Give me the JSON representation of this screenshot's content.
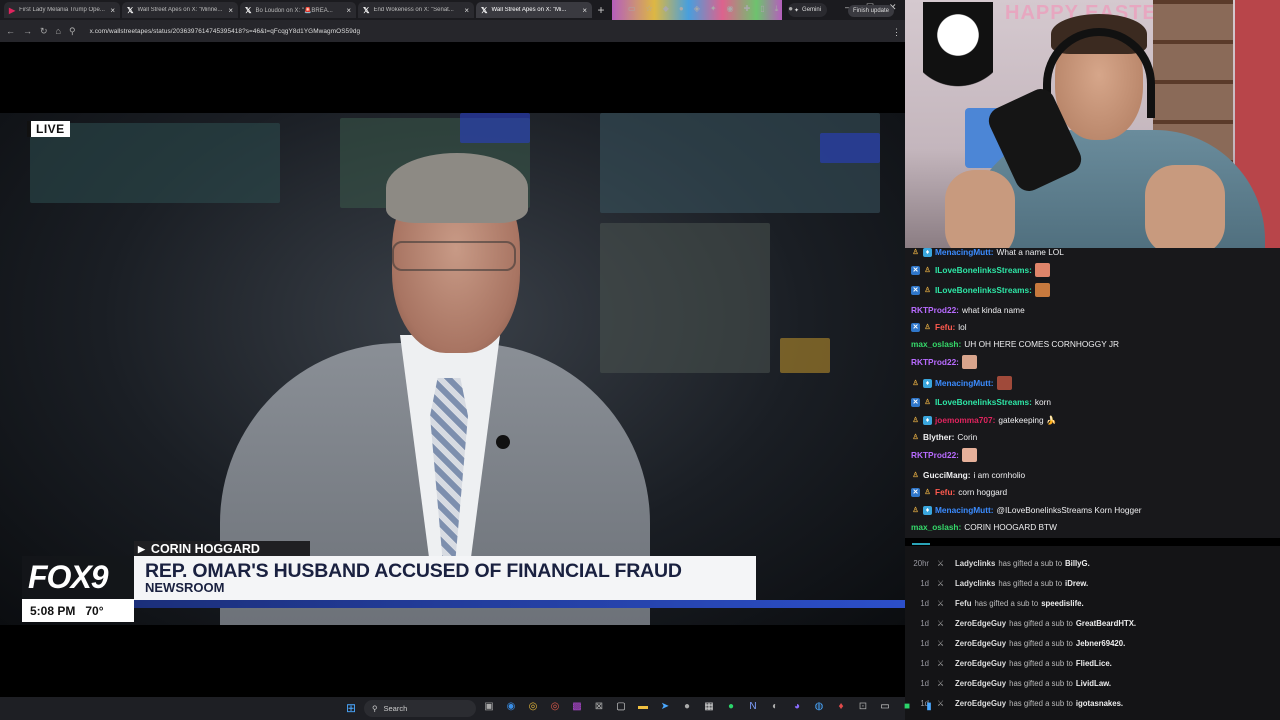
{
  "browser": {
    "tabs": [
      {
        "title": "First Lady Melania Trump Ope...",
        "icon": "youtube-icon",
        "active": false
      },
      {
        "title": "Wall Street Apes on X: \"Minne...",
        "icon": "x-icon",
        "active": false
      },
      {
        "title": "Bo Loudon on X: \"🚨BREA...",
        "icon": "x-icon",
        "active": false
      },
      {
        "title": "End Wokeness on X: \"Senat...",
        "icon": "x-icon",
        "active": false
      },
      {
        "title": "Wall Street Apes on X: \"Mi...",
        "icon": "x-icon",
        "active": true
      }
    ],
    "new_tab": "+",
    "gemini_label": "Gemini",
    "url": "x.com/wallstreetapes/status/2036397614745395418?s=46&t=qFcqgY8d1YGMwagmOS59dg",
    "finish_update": "Finish update"
  },
  "video": {
    "live_badge": "LIVE",
    "reporter_name": "CORIN HOGGARD",
    "network_logo": "FOX9",
    "time": "5:08 PM",
    "temperature": "70°",
    "headline": "REP. OMAR'S HUSBAND ACCUSED OF FINANCIAL FRAUD",
    "subline": "NEWSROOM"
  },
  "webcam": {
    "banner": "HAPPY EASTER"
  },
  "chat": {
    "messages": [
      {
        "user": "MenacingMutt:",
        "text": "What a name LOL",
        "color": "#3b8cff",
        "badges": [
          "gift",
          "prime"
        ]
      },
      {
        "user": "ILoveBonelinksStreams:",
        "text": "",
        "color": "#2ee6a6",
        "badges": [
          "sub",
          "gift"
        ],
        "emote": "#e0856a"
      },
      {
        "user": "ILoveBonelinksStreams:",
        "text": "",
        "color": "#2ee6a6",
        "badges": [
          "sub",
          "gift"
        ],
        "emote": "#c7793e"
      },
      {
        "user": "RKTProd22:",
        "text": "what kinda name",
        "color": "#b86bff",
        "badges": []
      },
      {
        "user": "Fefu:",
        "text": "lol",
        "color": "#ff5a4f",
        "badges": [
          "sub",
          "gift"
        ]
      },
      {
        "user": "max_oslash:",
        "text": "UH OH HERE COMES CORNHOGGY JR",
        "color": "#35d96a",
        "badges": []
      },
      {
        "user": "RKTProd22:",
        "text": "",
        "color": "#b86bff",
        "badges": [],
        "emote": "#d8a48c"
      },
      {
        "user": "MenacingMutt:",
        "text": "",
        "color": "#3b8cff",
        "badges": [
          "gift",
          "prime"
        ],
        "emote": "#a04a3a"
      },
      {
        "user": "ILoveBonelinksStreams:",
        "text": "korn",
        "color": "#2ee6a6",
        "badges": [
          "sub",
          "gift"
        ]
      },
      {
        "user": "joemomma707:",
        "text": "gatekeeping 🍌",
        "color": "#e0245e",
        "badges": [
          "gift",
          "prime"
        ]
      },
      {
        "user": "Blyther:",
        "text": "Corin",
        "color": "#efeff1",
        "badges": [
          "gift"
        ]
      },
      {
        "user": "RKTProd22:",
        "text": "",
        "color": "#b86bff",
        "badges": [],
        "emote": "#e6b09a"
      },
      {
        "user": "GucciMang:",
        "text": "i am cornholio",
        "color": "#efeff1",
        "badges": [
          "gift"
        ]
      },
      {
        "user": "Fefu:",
        "text": "corn hoggard",
        "color": "#ff5a4f",
        "badges": [
          "sub",
          "gift"
        ]
      },
      {
        "user": "MenacingMutt:",
        "text": "@ILoveBonelinksStreams Korn Hogger",
        "color": "#3b8cff",
        "badges": [
          "gift",
          "prime"
        ]
      },
      {
        "user": "max_oslash:",
        "text": "CORIN HOOGARD BTW",
        "color": "#35d96a",
        "badges": []
      }
    ]
  },
  "events": {
    "items": [
      {
        "age": "20hr",
        "giver": "Ladyclinks",
        "text": "has gifted a sub to",
        "recipient": "BillyG."
      },
      {
        "age": "1d",
        "giver": "Ladyclinks",
        "text": "has gifted a sub to",
        "recipient": "iDrew."
      },
      {
        "age": "1d",
        "giver": "Fefu",
        "text": "has gifted a sub to",
        "recipient": "speedislife."
      },
      {
        "age": "1d",
        "giver": "ZeroEdgeGuy",
        "text": "has gifted a sub to",
        "recipient": "GreatBeardHTX."
      },
      {
        "age": "1d",
        "giver": "ZeroEdgeGuy",
        "text": "has gifted a sub to",
        "recipient": "Jebner69420."
      },
      {
        "age": "1d",
        "giver": "ZeroEdgeGuy",
        "text": "has gifted a sub to",
        "recipient": "FliedLice."
      },
      {
        "age": "1d",
        "giver": "ZeroEdgeGuy",
        "text": "has gifted a sub to",
        "recipient": "LividLaw."
      },
      {
        "age": "1d",
        "giver": "ZeroEdgeGuy",
        "text": "has gifted a sub to",
        "recipient": "igotasnakes."
      }
    ]
  },
  "taskbar": {
    "search_placeholder": "Search"
  }
}
